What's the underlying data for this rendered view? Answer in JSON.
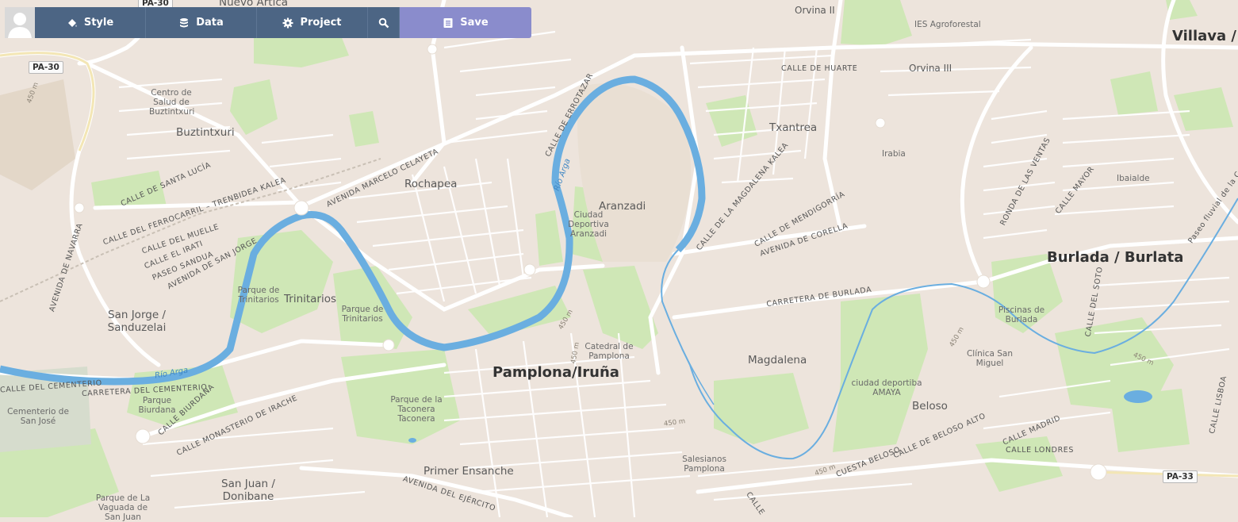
{
  "toolbar": {
    "style_label": "Style",
    "data_label": "Data",
    "project_label": "Project",
    "save_label": "Save"
  },
  "map": {
    "colors": {
      "land": "#ede4dc",
      "park": "#c8e6b0",
      "water": "#6aaee0",
      "road": "#ffffff",
      "major_road": "#fbfaf7"
    },
    "places": {
      "villava": "Villava / A",
      "burlada": "Burlada / Burlata",
      "pamplona": "Pamplona/Iruña",
      "buztintxuri": "Buztintxuri",
      "rochapea": "Rochapea",
      "aranzadi": "Aranzadi",
      "txantrea": "Txantrea",
      "orvina2": "Orvina II",
      "orvina3": "Orvina III",
      "trinitarios": "Trinitarios",
      "san_jorge": "San Jorge / Sanduzelai",
      "magdalena": "Magdalena",
      "beloso": "Beloso",
      "primer_ensanche": "Primer Ensanche",
      "san_juan": "San Juan / Donibane",
      "nuevo_artica": "Nuevo Artica"
    },
    "pois": {
      "ies": "IES Agroforestal",
      "centro_salud": "Centro de Salud de Buztintxuri",
      "ciudad_deportiva": "Ciudad Deportiva Aranzadi",
      "irabia": "Irabia",
      "ibaialde": "Ibaialde",
      "parque_trinitarios1": "Parque de Trinitarios",
      "parque_trinitarios2": "Parque de Trinitarios",
      "catedral": "Catedral de Pamplona",
      "piscinas": "Piscinas de Burlada",
      "clinica": "Clínica San Miguel",
      "amaya": "ciudad deportiba AMAYA",
      "cementerio": "Cementerio de San José",
      "parque_biurdana": "Parque Biurdana",
      "parque_taconera": "Parque de la Taconera Taconera",
      "salesianos": "Salesianos Pamplona",
      "vaguada": "Parque de La Vaguada de San Juan"
    },
    "streets": {
      "huarte": "CALLE DE HUARTE",
      "errotazar": "CALLE DE ERROTAZAR",
      "marcelo": "AVENIDA MARCELO CELAYETA",
      "santa_lucia": "CALLE DE SANTA LUCÍA",
      "ferrocarril": "CALLE DEL FERROCARRIL – TRENBIDEA KALEA",
      "muelle": "CALLE DEL MUELLE",
      "irati": "CALLE EL IRATI",
      "paseo_sandua": "PASEO SANDUA",
      "san_jorge_av": "AVENIDA DE SAN JORGE",
      "navarra": "AVENIDA DE NAVARRA",
      "magdalena_k": "CALLE DE LA MAGDALENA KALEA",
      "mendigorria": "CALLE DE MENDIGORRÍA",
      "corella": "AVENIDA DE CORELLA",
      "carretera_burlada": "CARRETERA DE BURLADA",
      "ventas": "RONDA DE LAS VENTAS",
      "mayor": "CALLE MAYOR",
      "soto": "CALLE DEL SOTO",
      "paseo_fluvial": "Paseo fluvial de la Com",
      "cementerio_c": "CALLE DEL CEMENTERIO",
      "carretera_cementerio": "CARRETERA DEL CEMENTERIO",
      "biurdana": "CALLE BIURDANA",
      "irache": "CALLE MONASTERIO DE IRACHE",
      "ejercito": "AVENIDA DEL EJÉRCITO",
      "cuesta_beloso": "CUESTA BELOSO",
      "beloso_alto": "CALLE DE BELOSO ALTO",
      "madrid": "CALLE MADRID",
      "londres": "CALLE LONDRES",
      "lisboa": "CALLE LISBOA",
      "calle_bottom": "CALLE"
    },
    "rivers": {
      "arga1": "Río Arga",
      "arga2": "Río Arga"
    },
    "shields": {
      "pa30_top": "PA-30",
      "pa30_left": "PA-30",
      "pa33": "PA-33"
    },
    "elevations": {
      "e1": "450 m",
      "e2": "450 m",
      "e3": "450 m",
      "e4": "450 m",
      "e5": "450 m",
      "e6": "450 m",
      "e7": "450 m"
    }
  }
}
